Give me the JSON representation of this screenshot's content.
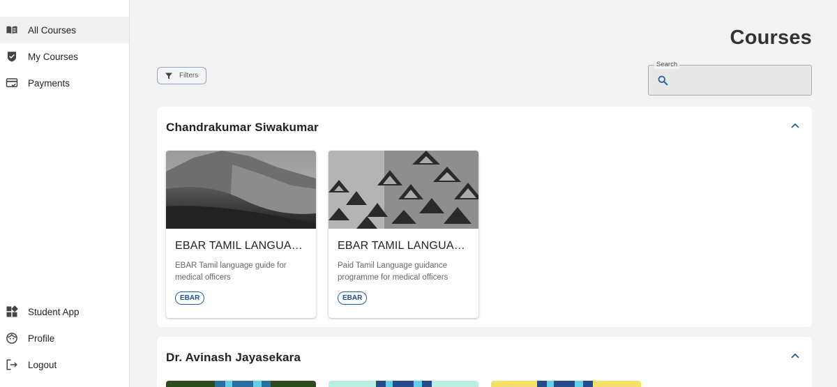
{
  "sidebar": {
    "top_items": [
      {
        "label": "All Courses",
        "icon": "book-open-icon",
        "active": true
      },
      {
        "label": "My Courses",
        "icon": "shield-check-icon"
      },
      {
        "label": "Payments",
        "icon": "card-check-icon"
      }
    ],
    "bottom_items": [
      {
        "label": "Student App",
        "icon": "dashboard-icon"
      },
      {
        "label": "Profile",
        "icon": "face-icon"
      },
      {
        "label": "Logout",
        "icon": "logout-icon"
      }
    ]
  },
  "header": {
    "title": "Courses"
  },
  "toolbar": {
    "filters_label": "Filters"
  },
  "search": {
    "label": "Search",
    "placeholder": ""
  },
  "sections": [
    {
      "instructor": "Chandrakumar Siwakumar",
      "courses": [
        {
          "title": "EBAR TAMIL LANGUAGE GUIDE",
          "description": "EBAR Tamil language guide for medical officers",
          "tag": "EBAR",
          "image": "mountain-landscape-photo"
        },
        {
          "title": "EBAR TAMIL LANGUAGE GUIDANCE PROGRAMME",
          "description": "Paid Tamil Language guidance programme for medical officers",
          "tag": "EBAR",
          "image": "pine-cone-photo"
        }
      ]
    },
    {
      "instructor": "Dr. Avinash Jayasekara",
      "courses": [
        {
          "image": "course-thumbnail-green"
        },
        {
          "image": "course-thumbnail-mint"
        },
        {
          "image": "course-thumbnail-yellow"
        }
      ]
    }
  ],
  "colors": {
    "accent": "#1e5ba8",
    "background": "#f3f3f3",
    "active_nav": "#f0f0f0"
  }
}
